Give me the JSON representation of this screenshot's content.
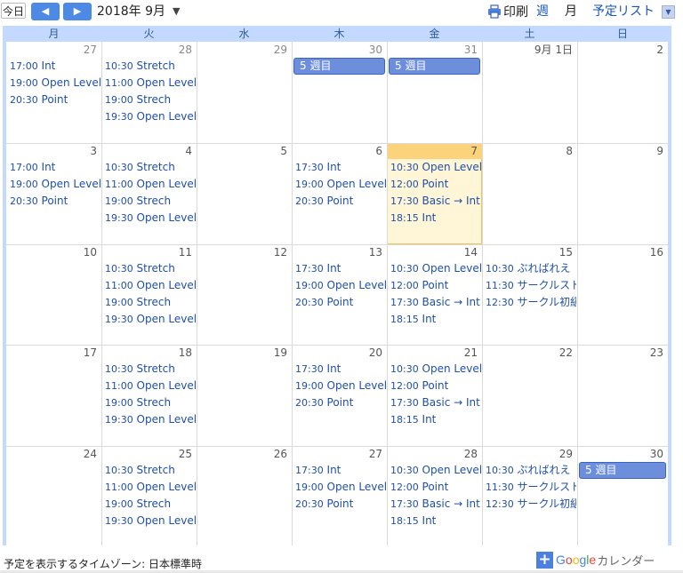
{
  "toolbar": {
    "today_label": "今日",
    "prev_label": "◀",
    "next_label": "▶",
    "date_label": "2018年 9月",
    "date_caret": "▼",
    "print_label": "印刷",
    "week_label": "週",
    "month_label": "月",
    "agenda_label": "予定リスト",
    "agenda_caret": "▼"
  },
  "weekdays": [
    "月",
    "火",
    "水",
    "木",
    "金",
    "土",
    "日"
  ],
  "weeks": [
    {
      "days": [
        {
          "num": "27",
          "events": [
            {
              "time": "17:00",
              "title": "Int"
            },
            {
              "time": "19:00",
              "title": "Open Level"
            },
            {
              "time": "20:30",
              "title": "Point"
            }
          ]
        },
        {
          "num": "28",
          "events": [
            {
              "time": "10:30",
              "title": "Stretch"
            },
            {
              "time": "11:00",
              "title": "Open Level"
            },
            {
              "time": "19:00",
              "title": "Strech"
            },
            {
              "time": "19:30",
              "title": "Open Level"
            }
          ]
        },
        {
          "num": "29",
          "events": []
        },
        {
          "num": "30",
          "events": []
        },
        {
          "num": "31",
          "events": []
        },
        {
          "num": "9月 1日",
          "events": []
        },
        {
          "num": "2",
          "events": []
        }
      ],
      "allday": [
        {
          "label": "5 週目",
          "start": 3,
          "span": 1
        },
        {
          "label": "5 週目",
          "start": 4,
          "span": 1
        }
      ]
    },
    {
      "days": [
        {
          "num": "3",
          "events": [
            {
              "time": "17:00",
              "title": "Int"
            },
            {
              "time": "19:00",
              "title": "Open Level"
            },
            {
              "time": "20:30",
              "title": "Point"
            }
          ]
        },
        {
          "num": "4",
          "events": [
            {
              "time": "10:30",
              "title": "Stretch"
            },
            {
              "time": "11:00",
              "title": "Open Level"
            },
            {
              "time": "19:00",
              "title": "Strech"
            },
            {
              "time": "19:30",
              "title": "Open Level"
            }
          ]
        },
        {
          "num": "5",
          "events": []
        },
        {
          "num": "6",
          "events": [
            {
              "time": "17:30",
              "title": "Int"
            },
            {
              "time": "19:00",
              "title": "Open Level"
            },
            {
              "time": "20:30",
              "title": "Point"
            }
          ]
        },
        {
          "num": "7",
          "today": true,
          "events": [
            {
              "time": "10:30",
              "title": "Open Level"
            },
            {
              "time": "12:00",
              "title": "Point"
            },
            {
              "time": "17:30",
              "title": "Basic → Int"
            },
            {
              "time": "18:15",
              "title": "Int"
            }
          ]
        },
        {
          "num": "8",
          "events": []
        },
        {
          "num": "9",
          "events": []
        }
      ],
      "allday": []
    },
    {
      "days": [
        {
          "num": "10",
          "events": []
        },
        {
          "num": "11",
          "events": [
            {
              "time": "10:30",
              "title": "Stretch"
            },
            {
              "time": "11:00",
              "title": "Open Level"
            },
            {
              "time": "19:00",
              "title": "Strech"
            },
            {
              "time": "19:30",
              "title": "Open Level"
            }
          ]
        },
        {
          "num": "12",
          "events": []
        },
        {
          "num": "13",
          "events": [
            {
              "time": "17:30",
              "title": "Int"
            },
            {
              "time": "19:00",
              "title": "Open Level"
            },
            {
              "time": "20:30",
              "title": "Point"
            }
          ]
        },
        {
          "num": "14",
          "events": [
            {
              "time": "10:30",
              "title": "Open Level"
            },
            {
              "time": "12:00",
              "title": "Point"
            },
            {
              "time": "17:30",
              "title": "Basic → Int"
            },
            {
              "time": "18:15",
              "title": "Int"
            }
          ]
        },
        {
          "num": "15",
          "events": [
            {
              "time": "10:30",
              "title": "ぶればれえ"
            },
            {
              "time": "11:30",
              "title": "サークルスト"
            },
            {
              "time": "12:30",
              "title": "サークル初級"
            }
          ]
        },
        {
          "num": "16",
          "events": []
        }
      ],
      "allday": []
    },
    {
      "days": [
        {
          "num": "17",
          "events": []
        },
        {
          "num": "18",
          "events": [
            {
              "time": "10:30",
              "title": "Stretch"
            },
            {
              "time": "11:00",
              "title": "Open Level"
            },
            {
              "time": "19:00",
              "title": "Strech"
            },
            {
              "time": "19:30",
              "title": "Open Level"
            }
          ]
        },
        {
          "num": "19",
          "events": []
        },
        {
          "num": "20",
          "events": [
            {
              "time": "17:30",
              "title": "Int"
            },
            {
              "time": "19:00",
              "title": "Open Level"
            },
            {
              "time": "20:30",
              "title": "Point"
            }
          ]
        },
        {
          "num": "21",
          "events": [
            {
              "time": "10:30",
              "title": "Open Level"
            },
            {
              "time": "12:00",
              "title": "Point"
            },
            {
              "time": "17:30",
              "title": "Basic → Int"
            },
            {
              "time": "18:15",
              "title": "Int"
            }
          ]
        },
        {
          "num": "22",
          "events": []
        },
        {
          "num": "23",
          "events": []
        }
      ],
      "allday": []
    },
    {
      "days": [
        {
          "num": "24",
          "events": []
        },
        {
          "num": "25",
          "events": [
            {
              "time": "10:30",
              "title": "Stretch"
            },
            {
              "time": "11:00",
              "title": "Open Level"
            },
            {
              "time": "19:00",
              "title": "Strech"
            },
            {
              "time": "19:30",
              "title": "Open Level"
            }
          ]
        },
        {
          "num": "26",
          "events": []
        },
        {
          "num": "27",
          "events": [
            {
              "time": "17:30",
              "title": "Int"
            },
            {
              "time": "19:00",
              "title": "Open Level"
            },
            {
              "time": "20:30",
              "title": "Point"
            }
          ]
        },
        {
          "num": "28",
          "events": [
            {
              "time": "10:30",
              "title": "Open Level"
            },
            {
              "time": "12:00",
              "title": "Point"
            },
            {
              "time": "17:30",
              "title": "Basic → Int"
            },
            {
              "time": "18:15",
              "title": "Int"
            }
          ]
        },
        {
          "num": "29",
          "events": [
            {
              "time": "10:30",
              "title": "ぶればれえ"
            },
            {
              "time": "11:30",
              "title": "サークルスト"
            },
            {
              "time": "12:30",
              "title": "サークル初級"
            }
          ]
        },
        {
          "num": "30",
          "events": []
        }
      ],
      "allday": [
        {
          "label": "5 週目",
          "start": 6,
          "span": 1
        }
      ]
    }
  ],
  "footer": {
    "timezone_label": "予定を表示するタイムゾーン: 日本標準時",
    "google_letters": [
      "G",
      "o",
      "o",
      "g",
      "l",
      "e"
    ],
    "google_colors": [
      "#4285f4",
      "#ea4335",
      "#fbbc05",
      "#4285f4",
      "#34a853",
      "#ea4335"
    ],
    "calendar_label": "カレンダー",
    "plus_label": "+"
  }
}
